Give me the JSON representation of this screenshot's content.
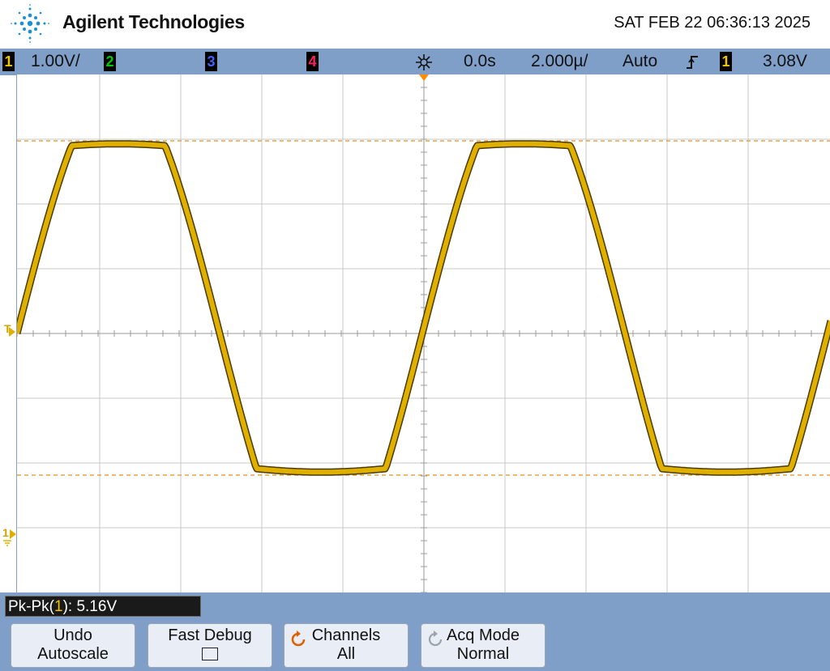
{
  "header": {
    "brand": "Agilent Technologies",
    "datetime": "SAT FEB 22 06:36:13 2025"
  },
  "status": {
    "ch1": {
      "number": "1",
      "scale": "1.00V/",
      "color": "#f2c500"
    },
    "ch2": {
      "number": "2",
      "color": "#00c800"
    },
    "ch3": {
      "number": "3",
      "color": "#4060ff"
    },
    "ch4": {
      "number": "4",
      "color": "#ff2060"
    },
    "delay": "0.0s",
    "timebase": "2.000µ/",
    "trigger_mode": "Auto",
    "trigger_slope_icon": "rising-edge-icon",
    "trigger_source": "1",
    "trigger_level": "3.08V"
  },
  "display": {
    "trigger_marker": "T",
    "ground_marker": "1",
    "trace_color": "#e0b000"
  },
  "measurement": {
    "prefix": "Pk-Pk(",
    "channel": "1",
    "suffix": "): 5.16V"
  },
  "softkeys": {
    "undo_line1": "Undo",
    "undo_line2": "Autoscale",
    "fast_debug": "Fast Debug",
    "channels_line1": "Channels",
    "channels_line2": "All",
    "acq_line1": "Acq Mode",
    "acq_line2": "Normal"
  }
}
